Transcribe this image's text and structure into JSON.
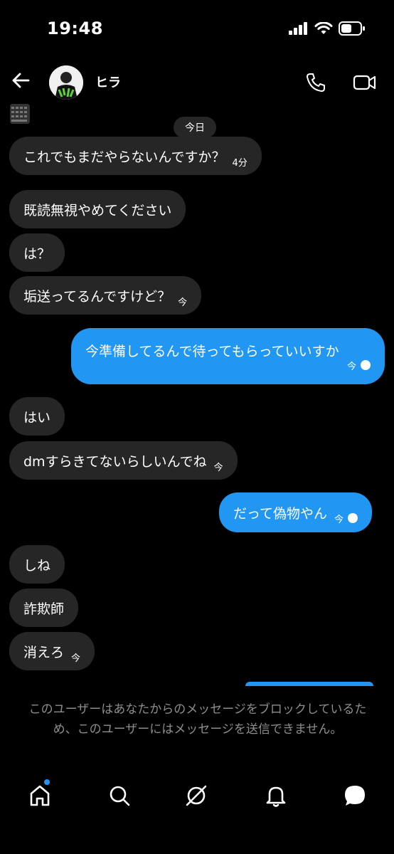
{
  "status_bar": {
    "time": "19:48"
  },
  "header": {
    "contact_name": "ヒラ"
  },
  "date_separator": "今日",
  "messages": [
    {
      "text": "これでもまだやらないんですか？",
      "time": "4分"
    },
    {
      "text": "既読無視やめてください"
    },
    {
      "text": "は？"
    },
    {
      "text": "垢送ってるんですけど？",
      "time": "今"
    },
    {
      "text": "今準備してるんで待ってもらっていいすか",
      "time": "今"
    },
    {
      "text": "はい"
    },
    {
      "text": "dmすらきてないらしいんでね",
      "time": "今"
    },
    {
      "text": "だって偽物やん",
      "time": "今"
    },
    {
      "text": "しね"
    },
    {
      "text": "詐欺師"
    },
    {
      "text": "消えろ",
      "time": "今"
    }
  ],
  "blocked_notice": "このユーザーはあなたからのメッセージをブロックしているため、このユーザーにはメッセージを送信できません。",
  "colors": {
    "outgoing": "#2196f3",
    "incoming": "#262626",
    "notice": "#8e8e8e"
  },
  "nav_icons": [
    "home-icon",
    "search-icon",
    "explore-icon",
    "bell-icon",
    "chat-icon"
  ]
}
